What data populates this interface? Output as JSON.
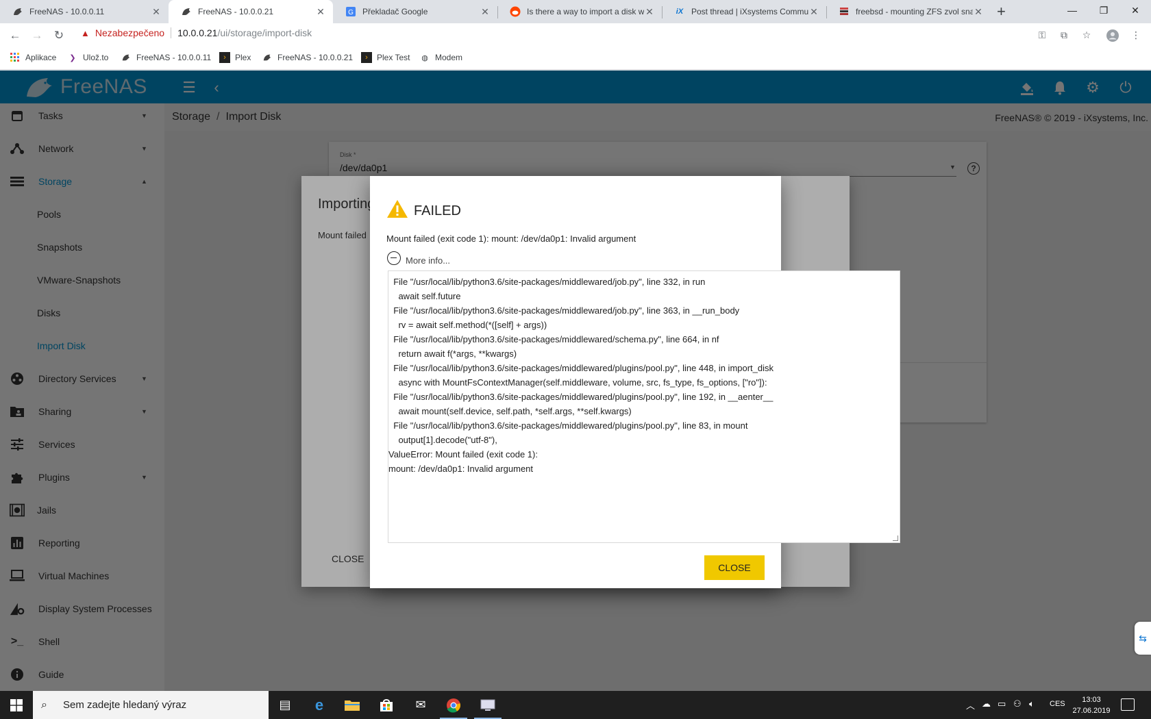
{
  "browser": {
    "tabs": [
      {
        "title": "FreeNAS - 10.0.0.11",
        "icon": "freenas-icon",
        "active": false
      },
      {
        "title": "FreeNAS - 10.0.0.21",
        "icon": "freenas-icon",
        "active": true
      },
      {
        "title": "Překladač Google",
        "icon": "google-translate-icon",
        "active": false
      },
      {
        "title": "Is there a way to import a disk wi",
        "icon": "reddit-icon",
        "active": false
      },
      {
        "title": "Post thread | iXsystems Commun",
        "icon": "ixsystems-icon",
        "active": false
      },
      {
        "title": "freebsd - mounting ZFS zvol snap",
        "icon": "stackexchange-icon",
        "active": false
      }
    ],
    "security_label": "Nezabezpečeno",
    "url_host": "10.0.0.21",
    "url_path": "/ui/storage/import-disk",
    "bookmarks": [
      {
        "label": "Aplikace",
        "icon": "apps-grid-icon"
      },
      {
        "label": "Ulož.to",
        "icon": "uloz-to-icon"
      },
      {
        "label": "FreeNAS - 10.0.0.11",
        "icon": "freenas-icon"
      },
      {
        "label": "Plex",
        "icon": "plex-icon"
      },
      {
        "label": "FreeNAS - 10.0.0.21",
        "icon": "freenas-icon"
      },
      {
        "label": "Plex Test",
        "icon": "plex-icon"
      },
      {
        "label": "Modem",
        "icon": "globe-icon"
      }
    ]
  },
  "app": {
    "logo_text": "FreeNAS",
    "copyright": "FreeNAS® © 2019 - iXsystems, Inc.",
    "breadcrumb": [
      "Storage",
      "Import Disk"
    ],
    "sidebar": [
      {
        "label": "Tasks",
        "icon": "calendar-icon",
        "expandable": true
      },
      {
        "label": "Network",
        "icon": "network-icon",
        "expandable": true
      },
      {
        "label": "Storage",
        "icon": "storage-icon",
        "expandable": true,
        "expanded": true,
        "selected": true
      },
      {
        "label": "Pools",
        "sub": true
      },
      {
        "label": "Snapshots",
        "sub": true
      },
      {
        "label": "VMware-Snapshots",
        "sub": true
      },
      {
        "label": "Disks",
        "sub": true
      },
      {
        "label": "Import Disk",
        "sub": true,
        "selected": true
      },
      {
        "label": "Directory Services",
        "icon": "directory-services-icon",
        "expandable": true
      },
      {
        "label": "Sharing",
        "icon": "sharing-icon",
        "expandable": true
      },
      {
        "label": "Services",
        "icon": "services-icon"
      },
      {
        "label": "Plugins",
        "icon": "plugins-icon",
        "expandable": true
      },
      {
        "label": "Jails",
        "icon": "jails-icon"
      },
      {
        "label": "Reporting",
        "icon": "reporting-icon"
      },
      {
        "label": "Virtual Machines",
        "icon": "virtual-machines-icon"
      },
      {
        "label": "Display System Processes",
        "icon": "system-processes-icon"
      },
      {
        "label": "Shell",
        "icon": "shell-icon"
      },
      {
        "label": "Guide",
        "icon": "guide-icon"
      }
    ],
    "form": {
      "disk_label": "Disk *",
      "disk_value": "/dev/da0p1"
    },
    "progress_dialog": {
      "title": "Importing",
      "message": "Mount failed",
      "close_label": "CLOSE"
    },
    "error_dialog": {
      "title": "FAILED",
      "message": "Mount failed (exit code 1): mount: /dev/da0p1: Invalid argument",
      "more_info_label": "More info...",
      "close_label": "CLOSE",
      "traceback": [
        "  File \"/usr/local/lib/python3.6/site-packages/middlewared/job.py\", line 332, in run",
        "    await self.future",
        "  File \"/usr/local/lib/python3.6/site-packages/middlewared/job.py\", line 363, in __run_body",
        "    rv = await self.method(*([self] + args))",
        "  File \"/usr/local/lib/python3.6/site-packages/middlewared/schema.py\", line 664, in nf",
        "    return await f(*args, **kwargs)",
        "  File \"/usr/local/lib/python3.6/site-packages/middlewared/plugins/pool.py\", line 448, in import_disk",
        "    async with MountFsContextManager(self.middleware, volume, src, fs_type, fs_options, [\"ro\"]):",
        "  File \"/usr/local/lib/python3.6/site-packages/middlewared/plugins/pool.py\", line 192, in __aenter__",
        "    await mount(self.device, self.path, *self.args, **self.kwargs)",
        "  File \"/usr/local/lib/python3.6/site-packages/middlewared/plugins/pool.py\", line 83, in mount",
        "    output[1].decode(\"utf-8\"),",
        "ValueError: Mount failed (exit code 1):",
        "mount: /dev/da0p1: Invalid argument"
      ]
    }
  },
  "taskbar": {
    "search_placeholder": "Sem zadejte hledaný výraz",
    "language": "CES",
    "time": "13:03",
    "date": "27.06.2019"
  },
  "colors": {
    "freenas_blue": "#0095d5",
    "close_button": "#f0c800",
    "warning": "#f5b800"
  }
}
